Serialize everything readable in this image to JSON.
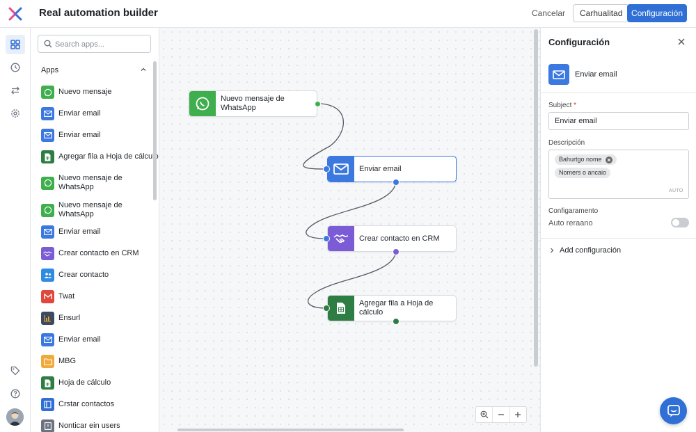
{
  "header": {
    "title": "Real automation builder",
    "cancel_label": "Cancelar",
    "secondary_label": "Carhualitad",
    "primary_label": "Configuración"
  },
  "rail": {
    "icons": [
      "grid-icon",
      "clock-icon",
      "transfer-icon",
      "gear-icon"
    ],
    "bottom_icons": [
      "tag-icon",
      "help-icon"
    ]
  },
  "apps_panel": {
    "search_placeholder": "Search apps...",
    "section_label": "Apps",
    "items": [
      {
        "label": "Nuevo mensaje",
        "icon": "whatsapp-icon",
        "color": "#3fae4d"
      },
      {
        "label": "Enviar email",
        "icon": "email-icon",
        "color": "#3b78e0"
      },
      {
        "label": "Enviar email",
        "icon": "email-icon",
        "color": "#3b78e0"
      },
      {
        "label": "Agregar fila a Hoja de cálculo",
        "icon": "sheet-icon",
        "color": "#2e7d43"
      },
      {
        "label": "Nuevo mensaje de WhatsApp",
        "icon": "whatsapp-icon",
        "color": "#3fae4d"
      },
      {
        "label": "Nuevo mensaje de WhatsApp",
        "icon": "whatsapp-icon",
        "color": "#3fae4d"
      },
      {
        "label": "Enviar email",
        "icon": "email-icon",
        "color": "#3b78e0"
      },
      {
        "label": "Crear contacto en CRM",
        "icon": "handshake-icon",
        "color": "#7b5cd6"
      },
      {
        "label": "Crear contacto",
        "icon": "contacts-icon",
        "color": "#2f8be0"
      },
      {
        "label": "Twat",
        "icon": "mail-m-icon",
        "color": "#e0483d"
      },
      {
        "label": "Ensurl",
        "icon": "chart-icon",
        "color": "#3d4b5c"
      },
      {
        "label": "Enviar email",
        "icon": "email-icon",
        "color": "#3b78e0"
      },
      {
        "label": "MBG",
        "icon": "folder-icon",
        "color": "#f2a93b"
      },
      {
        "label": "Hoja de cálculo",
        "icon": "sheet-icon",
        "color": "#2e7d43"
      },
      {
        "label": "Crstar contactos",
        "icon": "contacts-square-icon",
        "color": "#2f6fd6"
      },
      {
        "label": "Nonticar ein users",
        "icon": "notice-icon",
        "color": "#6b7380"
      }
    ]
  },
  "canvas": {
    "nodes": [
      {
        "label": "Nuevo mensaje de WhatsApp",
        "icon": "whatsapp-icon",
        "color": "#3fae4d"
      },
      {
        "label": "Enviar email",
        "icon": "email-icon",
        "color": "#3b78e0"
      },
      {
        "label": "Crear contacto en CRM",
        "icon": "handshake-icon",
        "color": "#7b5cd6"
      },
      {
        "label": "Agregar fila a Hoja de cálculo",
        "icon": "sheet-icon",
        "color": "#2e7d43"
      }
    ]
  },
  "config": {
    "title": "Configuración",
    "app_name": "Enviar email",
    "subject_label": "Subject",
    "required_mark": "*",
    "subject_value": "Enviar email",
    "description_label": "Descripción",
    "chips": [
      "Bahurtgo nome",
      "Nomers o ancaio"
    ],
    "auto_tag": "AUTO",
    "section_label": "Configaramento",
    "toggle_label": "Auto reraano",
    "toggle_on": false,
    "add_label": "Add configuración"
  },
  "colors": {
    "accent": "#2f6fd6",
    "selected_border": "#3b78e0",
    "port_in": "#3b78e0",
    "port_out": "#3fae4d"
  }
}
